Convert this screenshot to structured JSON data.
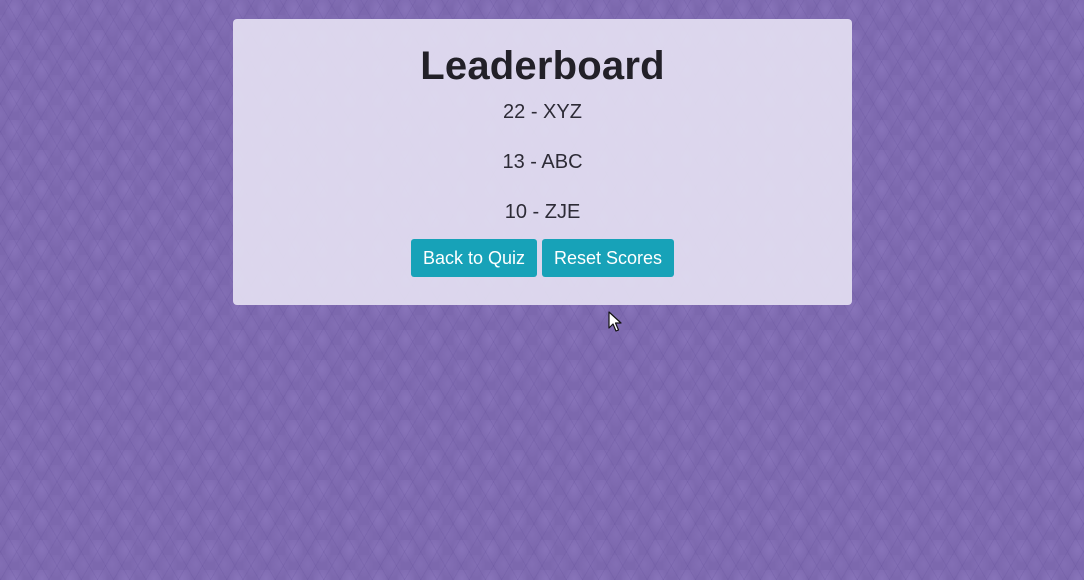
{
  "leaderboard": {
    "title": "Leaderboard",
    "scores": [
      {
        "text": "22 - XYZ"
      },
      {
        "text": "13 - ABC"
      },
      {
        "text": "10 - ZJE"
      }
    ]
  },
  "actions": {
    "back_label": "Back to Quiz",
    "reset_label": "Reset Scores"
  },
  "colors": {
    "background": "#7c68ae",
    "panel": "#e4e0f2",
    "button": "#17a2b8",
    "button_text": "#ffffff"
  },
  "icons": {
    "cursor": "mouse-pointer-icon"
  }
}
